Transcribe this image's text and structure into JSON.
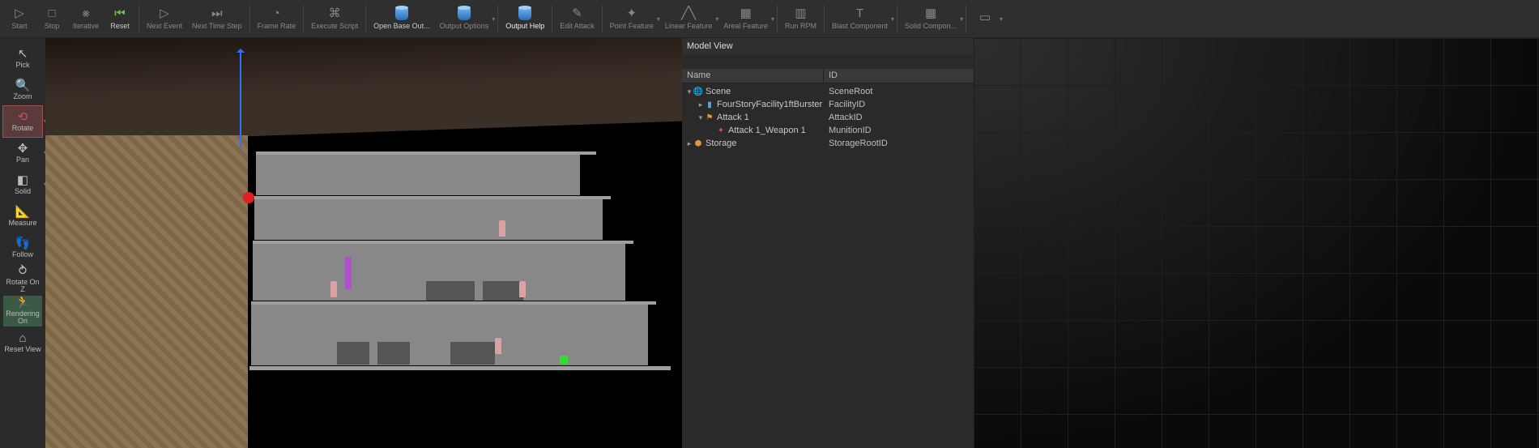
{
  "toolbar": {
    "start": "Start",
    "stop": "Stop",
    "iterative": "Iterative",
    "reset": "Reset",
    "next_event": "Next Event",
    "next_step": "Next Time Step",
    "frame_rate": "Frame Rate",
    "exec_script": "Execute Script",
    "open_base": "Open Base Out...",
    "output_opts": "Output Options",
    "output_help": "Output Help",
    "edit_attack": "Edit Attack",
    "point_feature": "Point Feature",
    "linear_feature": "Linear Feature",
    "areal_feature": "Areal Feature",
    "run_rpm": "Run RPM",
    "blast_comp": "Blast Component",
    "solid_comp": "Solid Compon...",
    "grid_comp": ""
  },
  "left": {
    "pick": "Pick",
    "zoom": "Zoom",
    "rotate": "Rotate",
    "pan": "Pan",
    "solid": "Solid",
    "measure": "Measure",
    "follow": "Follow",
    "rotate_z": "Rotate On Z",
    "rendering": "Rendering On",
    "reset_view": "Reset View"
  },
  "panel": {
    "title": "Model View",
    "col_name": "Name",
    "col_id": "ID",
    "rows": [
      {
        "indent": 0,
        "tw": "▾",
        "icon": "🌐",
        "ic": "c-orange",
        "name": "Scene",
        "id": "SceneRoot"
      },
      {
        "indent": 1,
        "tw": "▸",
        "icon": "▮",
        "ic": "c-blue",
        "name": "FourStoryFacility1ftBurster",
        "id": "FacilityID"
      },
      {
        "indent": 1,
        "tw": "▾",
        "icon": "⚑",
        "ic": "c-orange",
        "name": "Attack 1",
        "id": "AttackID"
      },
      {
        "indent": 2,
        "tw": "",
        "icon": "✦",
        "ic": "c-red",
        "name": "Attack 1_Weapon 1",
        "id": "MunitionID"
      },
      {
        "indent": 0,
        "tw": "▸",
        "icon": "⬢",
        "ic": "c-orange",
        "name": "Storage",
        "id": "StorageRootID"
      }
    ]
  }
}
